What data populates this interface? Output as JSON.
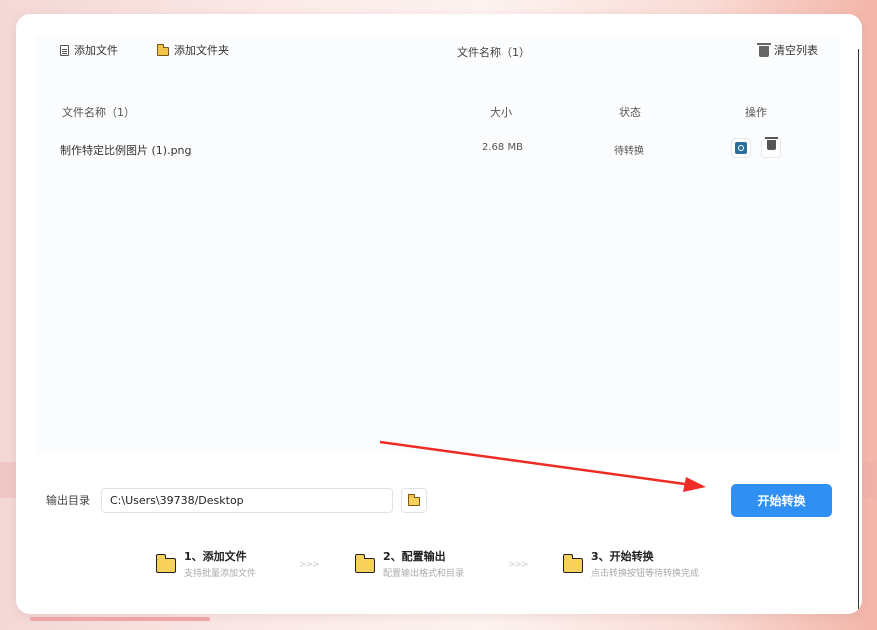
{
  "toolbar": {
    "add_file": "添加文件",
    "add_folder": "添加文件夹",
    "title": "文件名称（1）",
    "clear_list": "清空列表"
  },
  "table": {
    "headers": [
      "文件名称（1）",
      "大小",
      "状态",
      "操作"
    ],
    "rows": [
      {
        "name": "制作特定比例图片 (1).png",
        "size": "2.68 MB",
        "status": "待转换"
      }
    ]
  },
  "output": {
    "label": "输出目录",
    "path": "C:\\Users\\39738/Desktop"
  },
  "start_button": "开始转换",
  "steps": [
    {
      "title": "1、添加文件",
      "desc": "支持批量添加文件"
    },
    {
      "title": "2、配置输出",
      "desc": "配置输出格式和目录"
    },
    {
      "title": "3、开始转换",
      "desc": "点击转换按钮等待转换完成"
    }
  ],
  "step_separator": ">>>",
  "colors": {
    "primary": "#2f8ff3",
    "arrow": "#ee2b24",
    "folder": "#f8d15c"
  }
}
